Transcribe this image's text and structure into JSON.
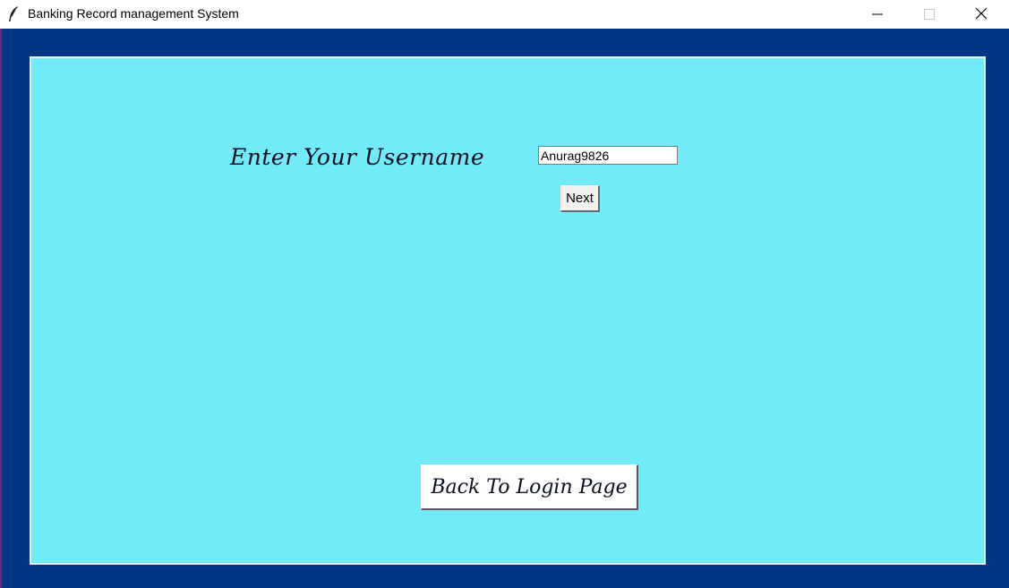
{
  "window": {
    "title": "Banking Record management System",
    "controls": {
      "minimize_icon": "minimize-icon",
      "maximize_icon": "maximize-icon",
      "close_icon": "close-icon"
    },
    "app_icon": "feather-icon"
  },
  "colors": {
    "frame_background": "#023583",
    "panel_background": "#73eaf8",
    "panel_border": "#dff4ff"
  },
  "form": {
    "username_label": "Enter Your Username",
    "username_value": "Anurag9826",
    "next_label": "Next",
    "back_label": "Back To Login Page"
  }
}
